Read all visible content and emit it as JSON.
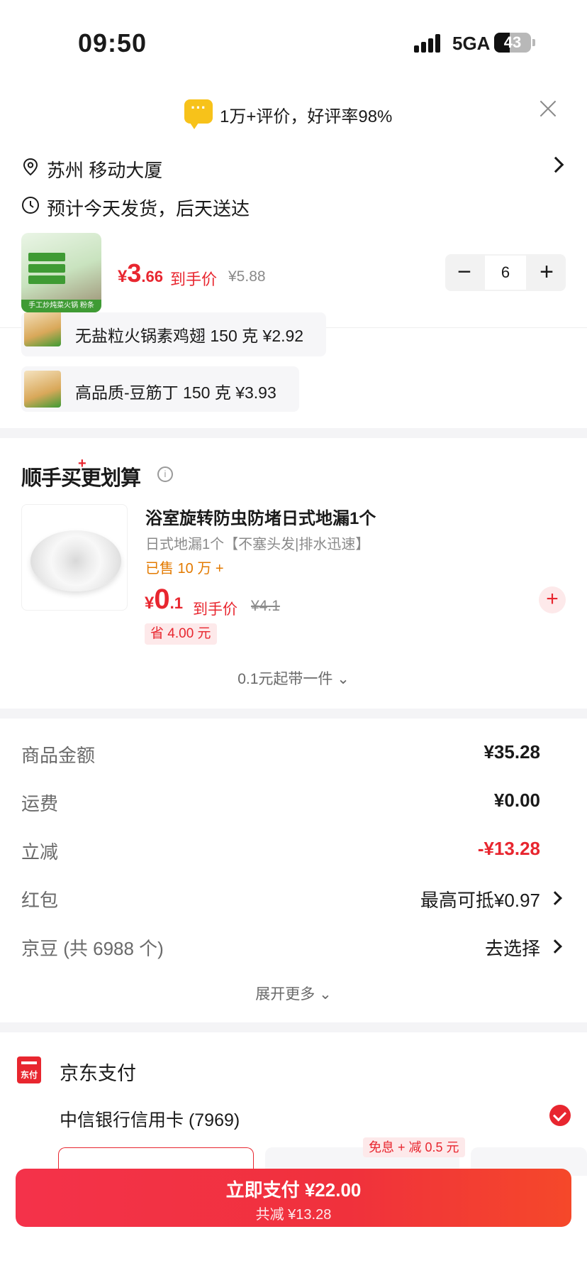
{
  "status_bar": {
    "time": "09:50",
    "network": "5GA",
    "battery": "43",
    "battery_level": 0.43
  },
  "rating_banner": {
    "text": "1万+评价，好评率98%",
    "chat_icon_text": "···"
  },
  "address": {
    "text": "苏州 移动大厦"
  },
  "shipping": {
    "text": "预计今天发货，后天送达"
  },
  "main_product": {
    "price_currency": "¥",
    "price_int": "3",
    "price_dec": ".66",
    "price_label": "到手价",
    "original_price": "¥5.88",
    "quantity": "6",
    "thumb_band": "手工炒炖菜火锅 粉条"
  },
  "gifts": [
    {
      "text": "无盐粒火锅素鸡翅 150 克  ¥2.92"
    },
    {
      "text": "高品质-豆筋丁 150 克  ¥3.93"
    }
  ],
  "addon": {
    "title": "顺手买更划算",
    "plus_mark": "+",
    "info_icon": "i",
    "name": "浴室旋转防虫防堵日式地漏1个",
    "sub": "日式地漏1个【不塞头发|排水迅速】",
    "sold": "已售 10 万 +",
    "price_currency": "¥",
    "price_int": "0",
    "price_dec": ".1",
    "price_label": "到手价",
    "original_price": "¥4.1",
    "save": "省 4.00 元",
    "add": "+",
    "more": "0.1元起带一件 ⌄"
  },
  "summary": {
    "rows": [
      {
        "label": "商品金额",
        "value": "¥35.28"
      },
      {
        "label": "运费",
        "value": "¥0.00"
      },
      {
        "label": "立减",
        "value": "-¥13.28"
      },
      {
        "label": "红包",
        "value": "最高可抵¥0.97"
      },
      {
        "label": "京豆 (共 6988 个)",
        "value": "去选择"
      }
    ],
    "expand": "展开更多 ⌄"
  },
  "payment": {
    "logo_text": "东付",
    "title": "京东支付",
    "card": "中信银行信用卡 (7969)",
    "promo": "免息 + 减 0.5 元"
  },
  "pay_button": {
    "label": "立即支付 ¥22.00",
    "sub": "共减 ¥13.28"
  },
  "colors": {
    "accent": "#e8262f",
    "muted": "#8a8a8a",
    "orange": "#e37a00"
  }
}
